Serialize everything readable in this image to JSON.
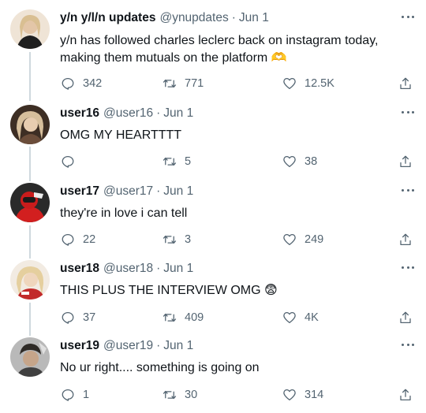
{
  "tweets": [
    {
      "name": "y/n y/l/n updates",
      "handle": "@ynupdates",
      "date": "Jun 1",
      "text": "y/n has followed charles leclerc back on instagram today, making them mutuals on the platform 🫶",
      "replies": "342",
      "retweets": "771",
      "likes": "12.5K",
      "avatar_colors": [
        "#d9c4ae",
        "#8a6a4f"
      ]
    },
    {
      "name": "user16",
      "handle": "@user16",
      "date": "Jun 1",
      "text": "OMG MY HEARTTTT",
      "replies": "",
      "retweets": "5",
      "likes": "38",
      "avatar_colors": [
        "#c9a98d",
        "#5c4636"
      ]
    },
    {
      "name": "user17",
      "handle": "@user17",
      "date": "Jun 1",
      "text": "they're in love i can tell",
      "replies": "22",
      "retweets": "3",
      "likes": "249",
      "avatar_colors": [
        "#d21f1f",
        "#2b2b2b"
      ]
    },
    {
      "name": "user18",
      "handle": "@user18",
      "date": "Jun 1",
      "text": "THIS PLUS THE INTERVIEW OMG 😨",
      "replies": "37",
      "retweets": "409",
      "likes": "4K",
      "avatar_colors": [
        "#e8c9a0",
        "#b22a2a"
      ]
    },
    {
      "name": "user19",
      "handle": "@user19",
      "date": "Jun 1",
      "text": "No ur right.... something is going on",
      "replies": "1",
      "retweets": "30",
      "likes": "314",
      "avatar_colors": [
        "#8c8c8c",
        "#3c3c3c"
      ]
    }
  ],
  "icons": {
    "reply": "reply-icon",
    "retweet": "retweet-icon",
    "like": "heart-icon",
    "share": "share-icon",
    "more": "more-icon"
  },
  "colors": {
    "text": "#0f1419",
    "secondary": "#536471",
    "thread_line": "#cfd9de"
  }
}
